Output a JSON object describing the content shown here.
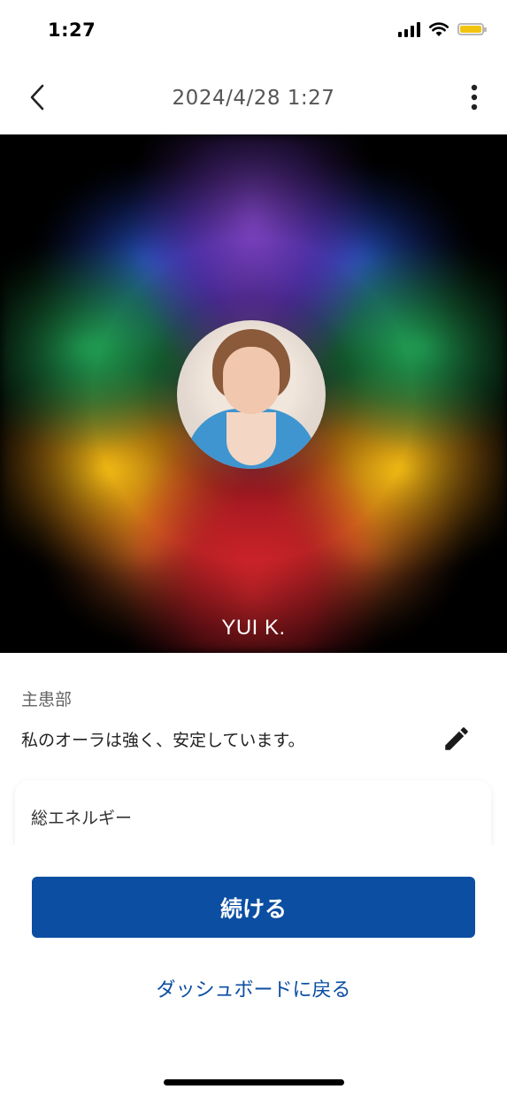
{
  "status_bar": {
    "time": "1:27",
    "icons": [
      "cellular-signal-icon",
      "wifi-icon",
      "battery-icon"
    ],
    "battery_color": "#f2c40f"
  },
  "nav": {
    "title": "2024/4/28 1:27",
    "back_icon": "chevron-left-icon",
    "more_icon": "more-vertical-icon"
  },
  "aura": {
    "name": "YUI K.",
    "colors": [
      "#dc282d",
      "#f0a014",
      "#f5be14",
      "#23aa5a",
      "#285ad2",
      "#8246c8"
    ]
  },
  "content": {
    "section_label": "主患部",
    "statement": "私のオーラは強く、安定しています。",
    "edit_icon": "pencil-icon",
    "energy_card_title": "総エネルギー"
  },
  "actions": {
    "continue_label": "続ける",
    "dashboard_label": "ダッシュボードに戻る",
    "primary_color": "#0b4ea2"
  }
}
